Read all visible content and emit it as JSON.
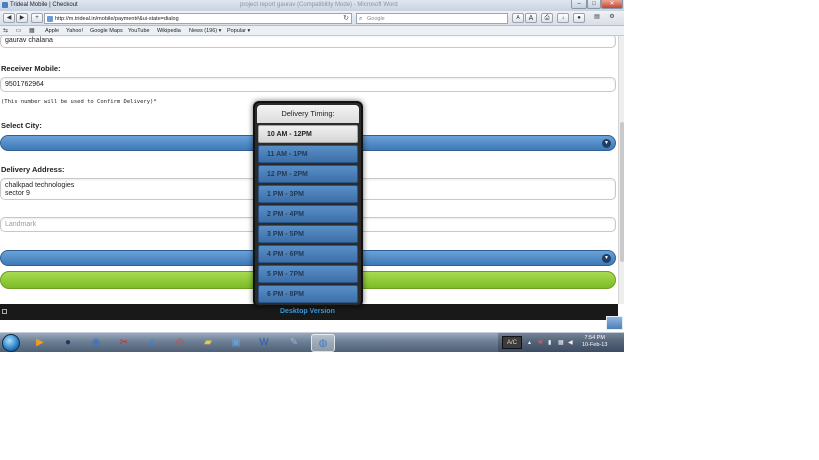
{
  "window": {
    "title": "Trideal Mobile | Checkout",
    "faint_title": "project report gaurav (Compatibility Mode) - Microsoft Word",
    "minimize": "–",
    "maximize": "□",
    "close": "✕"
  },
  "toolbar": {
    "back": "◀",
    "forward": "▶",
    "add": "+",
    "url": "http://m.trideal.in/mobile/payment#&ui-state=dialog",
    "reload": "↻",
    "search_placeholder": "Google",
    "text_smaller": "A",
    "text_larger": "A",
    "print": "⎙",
    "download": "↓",
    "stop": "●",
    "page_menu": "▤",
    "settings": "⚙"
  },
  "bookmarks": {
    "items": [
      "Apple",
      "Yahoo!",
      "Google Maps",
      "YouTube",
      "Wikipedia",
      "News (196) ▾",
      "Popular ▾"
    ]
  },
  "form": {
    "name_value": "gaurav chalana",
    "receiver_mobile_label": "Receiver Mobile:",
    "receiver_mobile_value": "9501762964",
    "confirm_note": "(This number will be used to Confirm Delivery)*",
    "city_label": "Select City:",
    "address_label": "Delivery Address:",
    "address_line1": "chalkpad technologies",
    "address_line2": "sector 9",
    "landmark_placeholder": "Landmark"
  },
  "footer": {
    "desktop_version": "Desktop Version"
  },
  "popup": {
    "title": "Delivery Timing:",
    "selected": "10 AM - 12PM",
    "options": [
      "10 AM - 12PM",
      "11 AM - 1PM",
      "12 PM - 2PM",
      "1 PM - 3PM",
      "2 PM - 4PM",
      "3 PM - 5PM",
      "4 PM - 6PM",
      "5 PM - 7PM",
      "6 PM - 8PM"
    ]
  },
  "taskbar": {
    "apps": [
      "windows-media-player",
      "network-globe",
      "browser-mozilla",
      "snipping-tool",
      "internet-explorer",
      "chrome",
      "file-explorer",
      "window-switcher",
      "word",
      "notepad",
      "safari"
    ],
    "active_app": "safari",
    "tray_label": "A/C",
    "time": "7:54 PM",
    "date": "10-Feb-13"
  }
}
